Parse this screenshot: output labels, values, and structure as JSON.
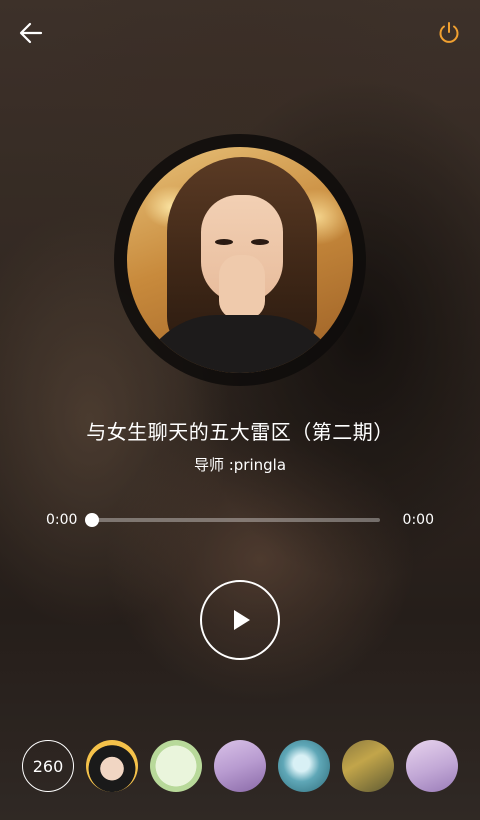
{
  "header": {
    "back_icon": "arrow-left-icon",
    "power_icon": "power-icon",
    "power_color": "#f0a030"
  },
  "track": {
    "title": "与女生聊天的五大雷区（第二期）",
    "subtitle": "导师 :pringla"
  },
  "player": {
    "current_time": "0:00",
    "total_time": "0:00",
    "progress": 0.0,
    "play_icon": "play-icon"
  },
  "listeners": {
    "count": "260"
  }
}
